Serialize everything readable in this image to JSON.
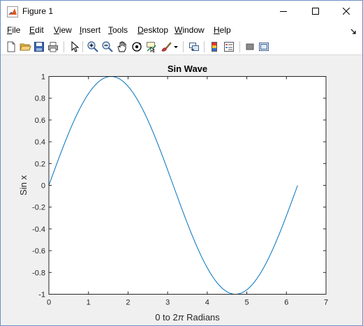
{
  "window": {
    "title": "Figure 1",
    "icon": "matlab-icon",
    "controls": [
      "minimize-icon",
      "maximize-icon",
      "close-icon"
    ]
  },
  "menu": {
    "items": [
      {
        "label": "File",
        "mnemonic": "F",
        "rest": "ile"
      },
      {
        "label": "Edit",
        "mnemonic": "E",
        "rest": "dit"
      },
      {
        "label": "View",
        "mnemonic": "V",
        "rest": "iew"
      },
      {
        "label": "Insert",
        "mnemonic": "I",
        "rest": "nsert"
      },
      {
        "label": "Tools",
        "mnemonic": "T",
        "rest": "ools"
      },
      {
        "label": "Desktop",
        "mnemonic": "D",
        "rest": "esktop"
      },
      {
        "label": "Window",
        "mnemonic": "W",
        "rest": "indow"
      },
      {
        "label": "Help",
        "mnemonic": "H",
        "rest": "elp"
      }
    ]
  },
  "toolbar": {
    "buttons": [
      "new-figure-icon",
      "open-file-icon",
      "save-icon",
      "print-icon",
      "edit-plot-icon",
      "zoom-in-icon",
      "zoom-out-icon",
      "pan-icon",
      "rotate-3d-icon",
      "data-cursor-icon",
      "brush-icon",
      "brush-dropdown-icon",
      "link-plot-icon",
      "insert-colorbar-icon",
      "insert-legend-icon",
      "hide-plot-tools-icon",
      "show-plot-tools-icon"
    ]
  },
  "chart_data": {
    "type": "line",
    "title": "Sin Wave",
    "xlabel_prefix": "0 to 2",
    "xlabel_symbol": "π",
    "xlabel_suffix": " Radians",
    "ylabel": "Sin x",
    "xlim": [
      0,
      7
    ],
    "ylim": [
      -1,
      1
    ],
    "xticks": [
      0,
      1,
      2,
      3,
      4,
      5,
      6,
      7
    ],
    "yticks": [
      -1,
      -0.8,
      -0.6,
      -0.4,
      -0.2,
      0,
      0.2,
      0.4,
      0.6,
      0.8,
      1
    ],
    "ytick_labels": [
      "-1",
      "-0.8",
      "-0.6",
      "-0.4",
      "-0.2",
      "0",
      "0.2",
      "0.4",
      "0.6",
      "0.8",
      "1"
    ],
    "grid": false,
    "line_color": "#0072bd",
    "series": [
      {
        "function": "sin",
        "x": [
          0,
          0.2513,
          0.5027,
          0.754,
          1.0053,
          1.2566,
          1.508,
          1.7593,
          2.0106,
          2.2619,
          2.5133,
          2.7646,
          3.0159,
          3.2673,
          3.5186,
          3.7699,
          4.0212,
          4.2726,
          4.5239,
          4.7752,
          5.0265,
          5.2779,
          5.5292,
          5.7805,
          6.0319,
          6.2832
        ],
        "y": [
          0,
          0.2487,
          0.4818,
          0.6845,
          0.8443,
          0.9511,
          0.998,
          0.9823,
          0.9048,
          0.7705,
          0.5878,
          0.3681,
          0.1253,
          -0.1253,
          -0.3681,
          -0.5878,
          -0.7705,
          -0.9048,
          -0.9823,
          -0.998,
          -0.9511,
          -0.8443,
          -0.6845,
          -0.4818,
          -0.2487,
          0
        ]
      }
    ]
  }
}
